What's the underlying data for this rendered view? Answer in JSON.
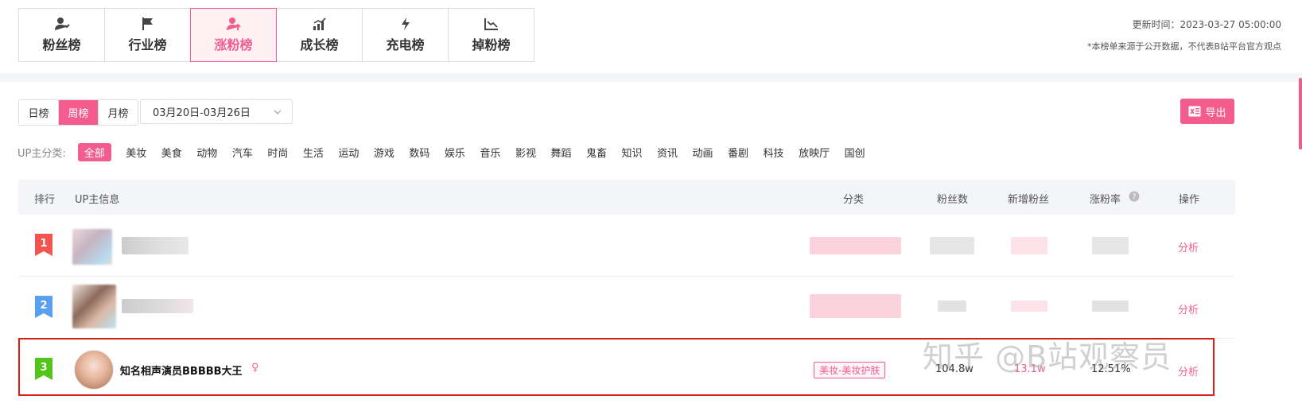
{
  "tabs": [
    {
      "label": "粉丝榜",
      "icon": "user-heart-icon",
      "active": false
    },
    {
      "label": "行业榜",
      "icon": "flag-icon",
      "active": false
    },
    {
      "label": "涨粉榜",
      "icon": "user-up-icon",
      "active": true
    },
    {
      "label": "成长榜",
      "icon": "growth-chart-icon",
      "active": false
    },
    {
      "label": "充电榜",
      "icon": "lightning-icon",
      "active": false
    },
    {
      "label": "掉粉榜",
      "icon": "line-chart-down-icon",
      "active": false
    }
  ],
  "header": {
    "update_time": "更新时间：2023-03-27 05:00:00",
    "notice": "*本榜单来源于公开数据，不代表B站平台官方观点"
  },
  "period": {
    "options": [
      "日榜",
      "周榜",
      "月榜"
    ],
    "selected": "周榜",
    "date_range": "03月20日-03月26日"
  },
  "export_label": "导出",
  "categories": {
    "label": "UP主分类:",
    "items": [
      "全部",
      "美妆",
      "美食",
      "动物",
      "汽车",
      "时尚",
      "生活",
      "运动",
      "游戏",
      "数码",
      "娱乐",
      "音乐",
      "影视",
      "舞蹈",
      "鬼畜",
      "知识",
      "资讯",
      "动画",
      "番剧",
      "科技",
      "放映厅",
      "国创"
    ],
    "selected": "全部"
  },
  "table": {
    "headers": {
      "rank": "排行",
      "info": "UP主信息",
      "category": "分类",
      "fans": "粉丝数",
      "new_fans": "新增粉丝",
      "growth": "涨粉率",
      "action": "操作"
    },
    "rows": [
      {
        "rank": "1",
        "rank_color": "#f2544f",
        "analyze": "分析"
      },
      {
        "rank": "2",
        "rank_color": "#5aa0ef",
        "analyze": "分析"
      },
      {
        "rank": "3",
        "rank_color": "#52c41a",
        "name": "知名相声演员BBBBB大王",
        "gender": "♀",
        "category": "美妆-美妆护肤",
        "fans": "104.8w",
        "new_fans": "13.1w",
        "growth": "12.51%",
        "analyze": "分析"
      }
    ]
  },
  "watermark": "知乎 @B站观察员",
  "colors": {
    "accent": "#f25d8e",
    "highlight_border": "#d91e18"
  }
}
